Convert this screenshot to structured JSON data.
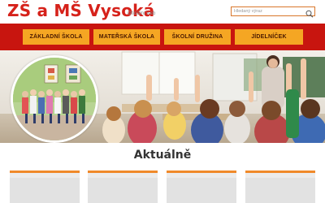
{
  "header": {
    "title": "ZŠ a MŠ Vysoká",
    "subtitle": "Oficiální web",
    "search": {
      "placeholder": "Hledaný výraz",
      "icon": "search-icon"
    }
  },
  "nav": {
    "items": [
      {
        "label": "základní škola"
      },
      {
        "label": "mateřská škola"
      },
      {
        "label": "školní družina"
      },
      {
        "label": "jídelníček"
      }
    ]
  },
  "news": {
    "heading": "Aktuálně",
    "cards": [
      {},
      {},
      {},
      {}
    ]
  },
  "colors": {
    "brand_red": "#c8150f",
    "title_red": "#d6221b",
    "nav_button": "#f5a623",
    "card_accent": "#f08a2a"
  }
}
